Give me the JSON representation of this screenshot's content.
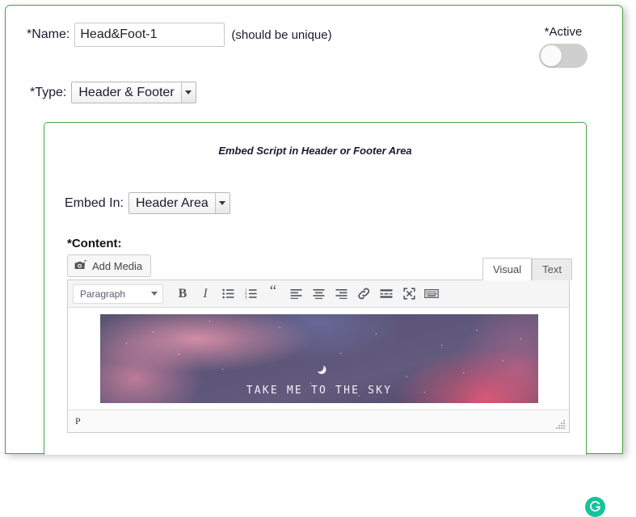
{
  "form": {
    "name_label": "*Name:",
    "name_value": "Head&Foot-1",
    "name_hint": "(should be unique)",
    "type_label": "*Type:",
    "type_value": "Header & Footer",
    "active_label": "*Active",
    "active_state": "off"
  },
  "panel": {
    "title": "Embed Script in Header or Footer Area",
    "embed_label": "Embed In:",
    "embed_value": "Header Area",
    "content_label": "*Content:"
  },
  "editor": {
    "add_media_label": "Add Media",
    "add_media_icon": "media-camera-music-icon",
    "tabs": [
      {
        "label": "Visual",
        "active": true
      },
      {
        "label": "Text",
        "active": false
      }
    ],
    "format_select": "Paragraph",
    "toolbar_icons": [
      "bold-icon",
      "italic-icon",
      "bulleted-list-icon",
      "numbered-list-icon",
      "blockquote-icon",
      "align-left-icon",
      "align-center-icon",
      "align-right-icon",
      "insert-link-icon",
      "read-more-icon",
      "fullscreen-icon",
      "keyboard-shortcuts-icon"
    ],
    "toolbar_glyphs": {
      "bold": "B",
      "italic": "I",
      "blockquote": "“"
    },
    "status_path": "P",
    "resize_handle": "resize-grip-icon"
  },
  "content_image": {
    "caption": "TAKE ME TO THE SKY",
    "alt": "night sky nebula with crescent moon",
    "moon_icon": "crescent-moon-icon"
  },
  "grammarly": {
    "name": "grammarly-badge-icon",
    "color": "#15c39a"
  },
  "colors": {
    "panel_border_green": "#46a546",
    "toggle_off": "#cfcfcf",
    "accent_green": "#15c39a"
  }
}
